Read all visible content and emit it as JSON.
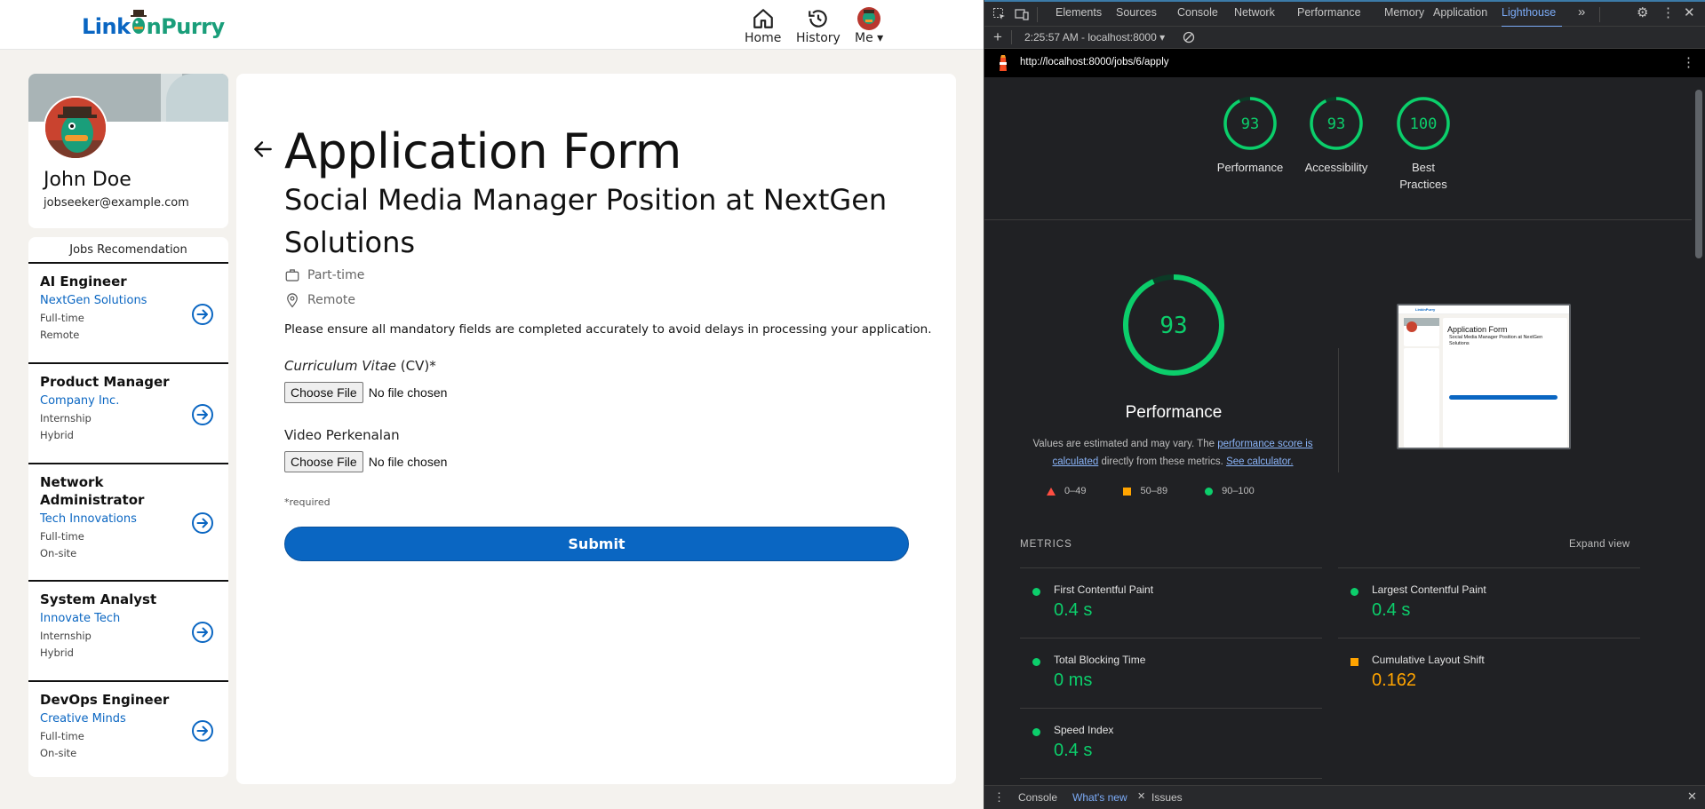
{
  "app": {
    "logo": {
      "part1": "Link",
      "part2": "n",
      "part3": "Purry"
    },
    "nav": {
      "home": "Home",
      "history": "History",
      "me": "Me"
    },
    "profile": {
      "name": "John Doe",
      "email": "jobseeker@example.com"
    },
    "jobs_title": "Jobs Recomendation",
    "jobs": [
      {
        "title": "AI Engineer",
        "company": "NextGen Solutions",
        "type": "Full-time",
        "location": "Remote"
      },
      {
        "title": "Product Manager",
        "company": "Company Inc.",
        "type": "Internship",
        "location": "Hybrid"
      },
      {
        "title": "Network Administrator",
        "company": "Tech Innovations",
        "type": "Full-time",
        "location": "On-site"
      },
      {
        "title": "System Analyst",
        "company": "Innovate Tech",
        "type": "Internship",
        "location": "Hybrid"
      },
      {
        "title": "DevOps Engineer",
        "company": "Creative Minds",
        "type": "Full-time",
        "location": "On-site"
      }
    ],
    "form": {
      "title": "Application Form",
      "subtitle": "Social Media Manager Position at NextGen Solutions",
      "job_type": "Part-time",
      "location": "Remote",
      "note": "Please ensure all mandatory fields are completed accurately to avoid delays in processing your application.",
      "cv_label_italic": "Curriculum Vitae",
      "cv_label_rest": " (CV)*",
      "video_label": "Video Perkenalan",
      "choose_file": "Choose File",
      "no_file": "No file chosen",
      "required_note": "*required",
      "submit": "Submit"
    }
  },
  "devtools": {
    "tabs": [
      "Elements",
      "Sources",
      "Console",
      "Network",
      "Performance",
      "Memory",
      "Application",
      "Lighthouse"
    ],
    "active_tab": "Lighthouse",
    "report_selector": "2:25:57 AM - localhost:8000",
    "url": "http://localhost:8000/jobs/6/apply",
    "scores": [
      {
        "label": "Performance",
        "value": 93
      },
      {
        "label": "Accessibility",
        "value": 93
      },
      {
        "label": "Best Practices",
        "value": 100
      }
    ],
    "main_score": 93,
    "main_label": "Performance",
    "desc_prefix": "Values are estimated and may vary. The ",
    "desc_link1": "performance score is calculated",
    "desc_mid": " directly from these metrics. ",
    "desc_link2": "See calculator.",
    "legend": {
      "fail": "0–49",
      "average": "50–89",
      "pass": "90–100"
    },
    "metrics_label": "METRICS",
    "expand_view": "Expand view",
    "metrics": [
      {
        "name": "First Contentful Paint",
        "value": "0.4 s",
        "rating": "pass"
      },
      {
        "name": "Largest Contentful Paint",
        "value": "0.4 s",
        "rating": "pass"
      },
      {
        "name": "Total Blocking Time",
        "value": "0 ms",
        "rating": "pass"
      },
      {
        "name": "Cumulative Layout Shift",
        "value": "0.162",
        "rating": "average"
      },
      {
        "name": "Speed Index",
        "value": "0.4 s",
        "rating": "pass"
      }
    ],
    "thumb": {
      "title": "Application Form",
      "subtitle": "Social Media Manager Position at NextGen Solutions"
    },
    "bottom_tabs": [
      "Console",
      "What's new",
      "Issues"
    ],
    "colors": {
      "pass": "#0cce6b",
      "average": "#ffa400",
      "fail": "#ff4e42",
      "accent": "#7cacf8",
      "brand": "#0a66c2"
    }
  }
}
